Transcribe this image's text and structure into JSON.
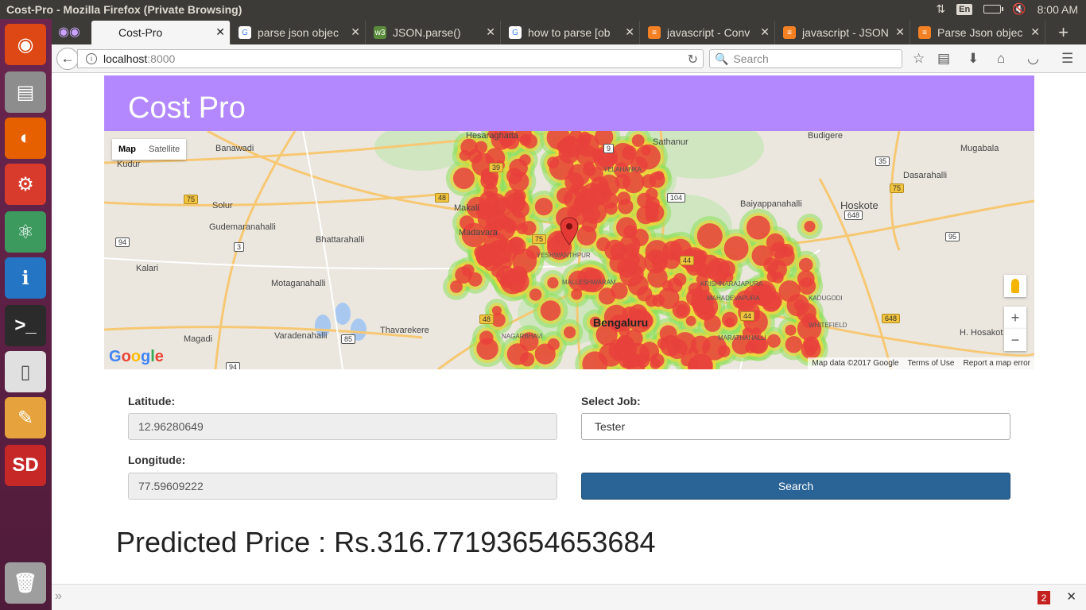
{
  "os": {
    "window_title": "Cost-Pro - Mozilla Firefox (Private Browsing)",
    "keyboard_layout": "En",
    "clock": "8:00 AM"
  },
  "launcher": {
    "items": [
      {
        "name": "ubuntu-dash-icon",
        "bg": "#dd4814",
        "glyph": "◉"
      },
      {
        "name": "files-icon",
        "bg": "#8d8d8d",
        "glyph": "▤"
      },
      {
        "name": "firefox-icon",
        "bg": "#e66000",
        "glyph": "◐"
      },
      {
        "name": "system-settings-icon",
        "bg": "#d83b2b",
        "glyph": "⚙"
      },
      {
        "name": "atom-icon",
        "bg": "#3c9a5f",
        "glyph": "⚛"
      },
      {
        "name": "ip-app-icon",
        "bg": "#2475c4",
        "glyph": "ℹ"
      },
      {
        "name": "terminal-icon",
        "bg": "#2b2b2b",
        "glyph": ">_"
      },
      {
        "name": "libreoffice-icon",
        "bg": "#e0e0e0",
        "glyph": "▯"
      },
      {
        "name": "text-editor-icon",
        "bg": "#e6a23c",
        "glyph": "✎"
      },
      {
        "name": "sd-card-icon",
        "bg": "#c62828",
        "glyph": "SD"
      },
      {
        "name": "trash-icon",
        "bg": "#9e9e9e",
        "glyph": "🗑"
      }
    ]
  },
  "tabs": [
    {
      "label": "Cost-Pro",
      "fav_bg": "transparent",
      "fav_glyph": ""
    },
    {
      "label": "parse json objec",
      "fav_bg": "#fff",
      "fav_glyph": "G"
    },
    {
      "label": "JSON.parse()",
      "fav_bg": "#5a8c3c",
      "fav_glyph": "w3"
    },
    {
      "label": "how to parse [ob",
      "fav_bg": "#fff",
      "fav_glyph": "G"
    },
    {
      "label": "javascript - Conv",
      "fav_bg": "#f48024",
      "fav_glyph": "≡"
    },
    {
      "label": "javascript - JSON",
      "fav_bg": "#f48024",
      "fav_glyph": "≡"
    },
    {
      "label": "Parse Json objec",
      "fav_bg": "#f48024",
      "fav_glyph": "≡"
    }
  ],
  "navbar": {
    "url_host": "localhost",
    "url_port": ":8000",
    "search_placeholder": "Search"
  },
  "page": {
    "brand": "Cost Pro",
    "map": {
      "type_map": "Map",
      "type_satellite": "Satellite",
      "city": "Bengaluru",
      "places": [
        "Banawadi",
        "Kudur",
        "Solur",
        "Gudemaranahalli",
        "Bhattarahalli",
        "Kalari",
        "Motaganahalli",
        "Magadi",
        "Varadenahalli",
        "Thavarekere",
        "Hesaraghatta",
        "Sathanur",
        "Budigere",
        "Mugabala",
        "Dasarahalli",
        "Baiyappanahalli",
        "Hoskote",
        "Makali",
        "Madavara",
        "YESHWANTHPUR",
        "MALLESHWARAM",
        "YELAHANKA",
        "KRISHNARAJAPURA",
        "MAHADEVAPURA",
        "KADUGODI",
        "WHITEFIELD",
        "NAGARBHAVI",
        "MARATHAHALLI",
        "H. Hosakot"
      ],
      "routes": [
        "39",
        "48",
        "75",
        "94",
        "3",
        "85",
        "9",
        "104",
        "35",
        "75",
        "648",
        "95",
        "44",
        "75",
        "44",
        "648",
        "48",
        "94"
      ],
      "attribution": "Map data ©2017 Google",
      "terms": "Terms of Use",
      "report": "Report a map error",
      "logo": "Google"
    },
    "form": {
      "latitude_label": "Latitude:",
      "latitude_value": "12.96280649",
      "longitude_label": "Longitude:",
      "longitude_value": "77.59609222",
      "job_label": "Select Job:",
      "job_selected": "Tester",
      "search_button": "Search"
    },
    "result": "Predicted Price : Rs.316.77193654653684"
  },
  "bottom_bar": {
    "badge_count": "2"
  },
  "colors": {
    "header_bg": "#b388ff",
    "button_bg": "#2a6496",
    "heat_hot": "#e8413c",
    "heat_warm": "#f5d53a",
    "heat_cool": "#8ee05a"
  }
}
